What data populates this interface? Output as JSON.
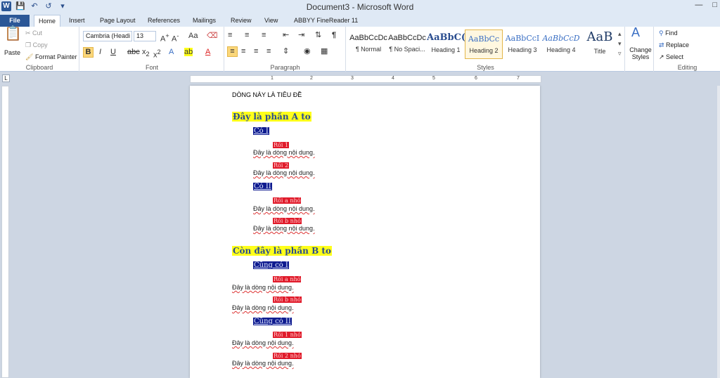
{
  "window": {
    "title": "Document3 - Microsoft Word"
  },
  "tabs": [
    "File",
    "Home",
    "Insert",
    "Page Layout",
    "References",
    "Mailings",
    "Review",
    "View",
    "ABBYY FineReader 11"
  ],
  "clipboard": {
    "paste": "Paste",
    "cut": "Cut",
    "copy": "Copy",
    "format_painter": "Format Painter",
    "label": "Clipboard"
  },
  "font": {
    "name": "Cambria (Headi",
    "size": "13",
    "label": "Font"
  },
  "paragraph": {
    "label": "Paragraph"
  },
  "styles": {
    "items": [
      {
        "preview": "AaBbCcDc",
        "name": "¶ Normal"
      },
      {
        "preview": "AaBbCcDc",
        "name": "¶ No Spaci..."
      },
      {
        "preview": "AaBbC(",
        "name": "Heading 1"
      },
      {
        "preview": "AaBbCc",
        "name": "Heading 2"
      },
      {
        "preview": "AaBbCcI",
        "name": "Heading 3"
      },
      {
        "preview": "AaBbCcD",
        "name": "Heading 4"
      },
      {
        "preview": "AaB",
        "name": "Title"
      }
    ],
    "change_styles": "Change Styles",
    "label": "Styles"
  },
  "editing": {
    "find": "Find",
    "replace": "Replace",
    "select": "Select",
    "label": "Editing"
  },
  "ruler": {
    "marks": [
      "1",
      "2",
      "3",
      "4",
      "5",
      "6",
      "7"
    ]
  },
  "document": {
    "title_line": "DÒNG NÀY LÀ TIÊU ĐỀ",
    "part_a": "Đây là phần A to",
    "co_i": "Có I",
    "roi_1": "Rồi 1",
    "roi_2": "Rồi 2",
    "co_ii": "Có II",
    "roi_a_nho": "Rồi a nhỏ",
    "roi_b_nho": "Rồi b nhỏ",
    "part_b": "Còn đây là phần B to",
    "cung_co_i": "Cũng có I",
    "roi_b_nho_2": "Rồi  b nhỏ",
    "cung_co_ii": "Cũng có II",
    "roi_1_nho": "Rồi 1 nhỏ",
    "roi_2_nho": "Rồi 2 nhỏ",
    "body": "Đây là dòng nội dung."
  }
}
